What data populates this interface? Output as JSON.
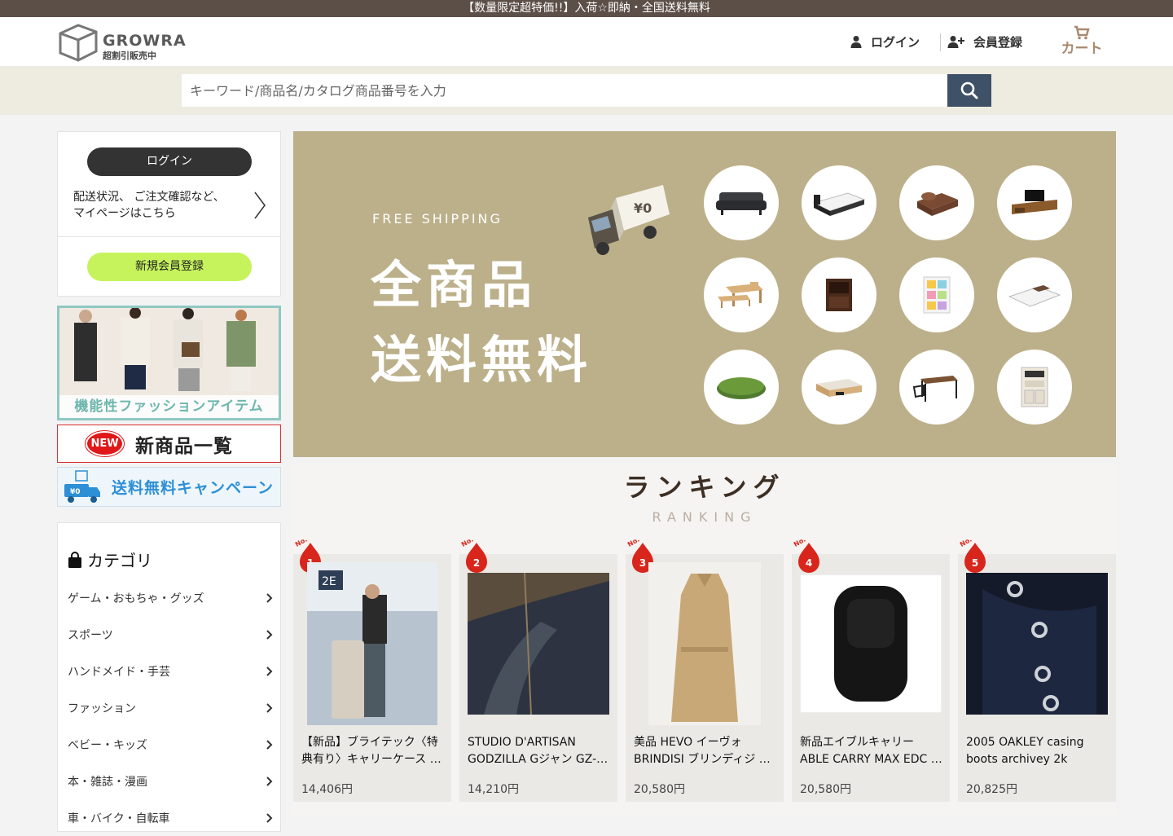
{
  "topbar": {
    "message": "【数量限定超特価!!】入荷☆即納・全国送料無料"
  },
  "header": {
    "logo_text": "GROWRA",
    "logo_sub": "超割引販売中",
    "login_label": "ログイン",
    "register_label": "会員登録",
    "cart_label": "カート"
  },
  "search": {
    "placeholder": "キーワード/商品名/カタログ商品番号を入力"
  },
  "sidebar": {
    "login_button": "ログイン",
    "login_desc_line1": "配送状況、 ご注文確認など、",
    "login_desc_line2": "マイページはこちら",
    "register_button": "新規会員登録",
    "fashion_banner": "機能性ファッションアイテム",
    "new_badge": "NEW",
    "new_banner": "新商品一覧",
    "free_banner": "送料無料キャンペーン",
    "category_title": "カテゴリ",
    "categories": [
      "ゲーム・おもちゃ・グッズ",
      "スポーツ",
      "ハンドメイド・手芸",
      "ファッション",
      "ベビー・キッズ",
      "本・雑誌・漫画",
      "車・バイク・自転車"
    ]
  },
  "hero": {
    "kicker": "FREE SHIPPING",
    "line1": "全商品",
    "line2": "送料無料",
    "truck_label": "¥0"
  },
  "ranking": {
    "title": "ランキング",
    "subtitle": "RANKING",
    "badge_prefix": "No.",
    "items": [
      {
        "rank": "1",
        "name": "【新品】ブライテック〈特典有り〉キャリーケース …",
        "price": "14,406円"
      },
      {
        "rank": "2",
        "name": "STUDIO D'ARTISAN GODZILLA Gジャン GZ-…",
        "price": "14,210円"
      },
      {
        "rank": "3",
        "name": "美品 HEVO イーヴォ BRINDISI ブリンディジ …",
        "price": "20,580円"
      },
      {
        "rank": "4",
        "name": "新品エイブルキャリー ABLE CARRY MAX EDC …",
        "price": "20,580円"
      },
      {
        "rank": "5",
        "name": "2005 OAKLEY casing boots archivey 2k",
        "price": "20,825円"
      }
    ]
  },
  "colors": {
    "topbar": "#5c4f47",
    "search_button": "#3f5166",
    "hero_bg": "#bbb08a",
    "register_green": "#c6f35c",
    "rank_red": "#d8261c"
  }
}
